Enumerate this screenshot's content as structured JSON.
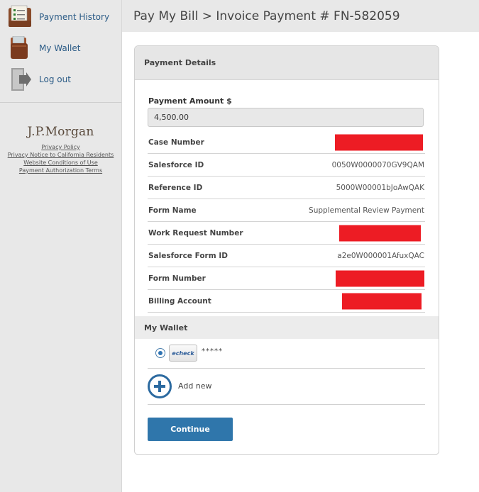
{
  "sidebar": {
    "items": [
      {
        "label": "Payment History",
        "icon": "payment-history-icon"
      },
      {
        "label": "My Wallet",
        "icon": "wallet-icon"
      },
      {
        "label": "Log out",
        "icon": "logout-icon"
      }
    ],
    "brand": "J.P.Morgan",
    "legal_links": [
      "Privacy Policy",
      "Privacy Notice to California Residents",
      "Website Conditions of Use",
      "Payment Authorization Terms"
    ]
  },
  "header": {
    "title": "Pay My Bill > Invoice Payment # FN-582059"
  },
  "payment_details": {
    "heading": "Payment Details",
    "amount_label": "Payment Amount $",
    "amount_value": "4,500.00",
    "rows": [
      {
        "label": "Case Number",
        "value": "",
        "redacted": true
      },
      {
        "label": "Salesforce ID",
        "value": "0050W0000070GV9QAM",
        "redacted": false
      },
      {
        "label": "Reference ID",
        "value": "5000W00001bJoAwQAK",
        "redacted": false
      },
      {
        "label": "Form Name",
        "value": "Supplemental Review Payment",
        "redacted": false
      },
      {
        "label": "Work Request Number",
        "value": "",
        "redacted": true
      },
      {
        "label": "Salesforce Form ID",
        "value": "a2e0W000001AfuxQAC",
        "redacted": false
      },
      {
        "label": "Form Number",
        "value": "",
        "redacted": true
      },
      {
        "label": "Billing Account",
        "value": "",
        "redacted": true
      }
    ]
  },
  "wallet": {
    "heading": "My Wallet",
    "method_badge": "echeck",
    "masked_account": "*****",
    "add_new_label": "Add new"
  },
  "actions": {
    "continue_label": "Continue"
  },
  "colors": {
    "link": "#2b5b86",
    "primary_button": "#2f76ab",
    "redaction": "#ed1c24",
    "panel_gray": "#e8e8e8"
  }
}
